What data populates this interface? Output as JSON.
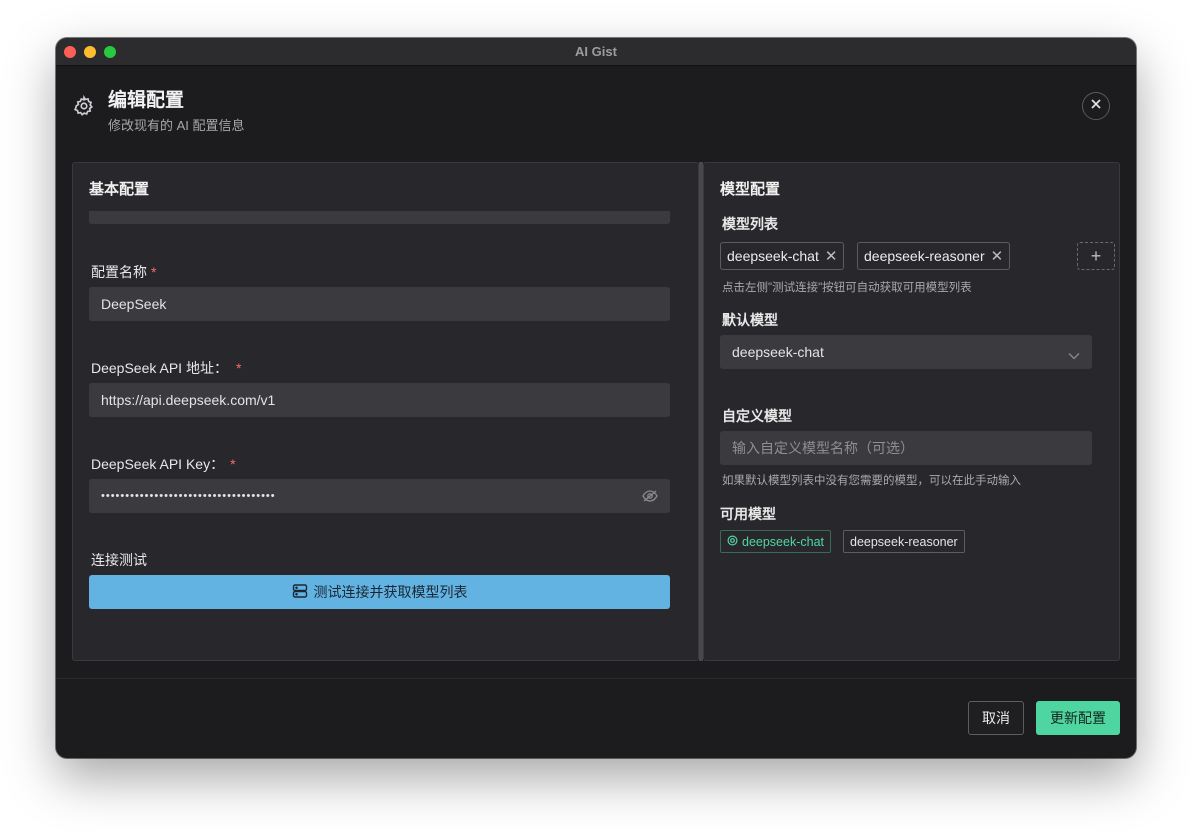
{
  "window": {
    "title": "AI Gist"
  },
  "dialog": {
    "title": "编辑配置",
    "subtitle": "修改现有的 AI 配置信息",
    "close_label": "✕"
  },
  "basic": {
    "title": "基本配置",
    "name_label": "配置名称",
    "name_value": "DeepSeek",
    "url_label": "DeepSeek API 地址：",
    "url_value": "https://api.deepseek.com/v1",
    "key_label": "DeepSeek API Key：",
    "key_value": "••••••••••••••••••••••••••••••••••••",
    "required_mark": "*",
    "test_section_label": "连接测试",
    "test_button_label": "测试连接并获取模型列表"
  },
  "model": {
    "title": "模型配置",
    "list_label": "模型列表",
    "tags": [
      "deepseek-chat",
      "deepseek-reasoner"
    ],
    "add_label": "+",
    "list_hint": "点击左侧\"测试连接\"按钮可自动获取可用模型列表",
    "default_label": "默认模型",
    "default_value": "deepseek-chat",
    "custom_label": "自定义模型",
    "custom_placeholder": "输入自定义模型名称（可选）",
    "custom_hint": "如果默认模型列表中没有您需要的模型，可以在此手动输入",
    "available_label": "可用模型",
    "available": [
      "deepseek-chat",
      "deepseek-reasoner"
    ]
  },
  "footer": {
    "cancel_label": "取消",
    "update_label": "更新配置"
  },
  "colors": {
    "accent_green": "#4fd6a0",
    "test_button_blue": "#62b2e2",
    "required_red": "#f56c6c"
  }
}
